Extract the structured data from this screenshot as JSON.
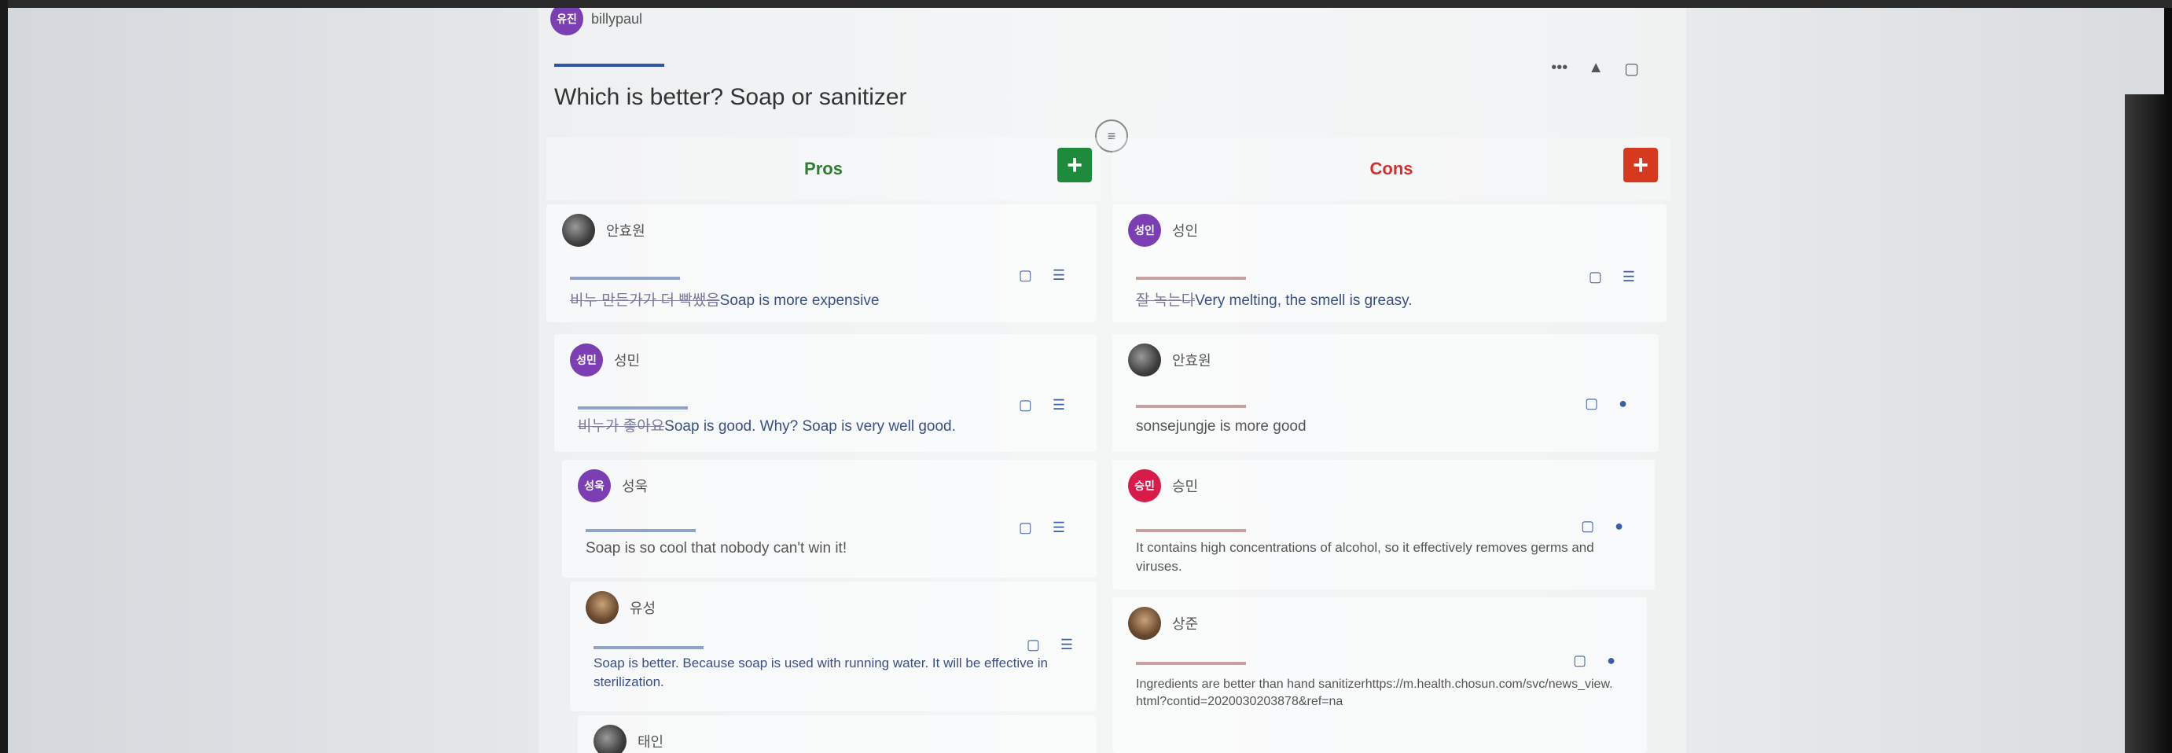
{
  "top_author": {
    "name": "billypaul",
    "initials": "유진"
  },
  "card": {
    "title": "Which is better? Soap or sanitizer"
  },
  "columns": {
    "pros_label": "Pros",
    "cons_label": "Cons",
    "add_symbol": "+"
  },
  "pros": [
    {
      "author": "안효원",
      "struck": "비누 만든가가 더 빡쌨음",
      "text": "Soap is more expensive"
    },
    {
      "author": "성민",
      "initials": "성민",
      "struck": "비누가 좋아요",
      "text": "Soap is good. Why? Soap is very well good."
    },
    {
      "author": "성욱",
      "initials": "성욱",
      "struck": "",
      "text": "Soap is so cool that nobody can't win it!"
    },
    {
      "author": "유성",
      "struck": "",
      "text": "Soap is better. Because soap is used with running water. It will be effective in sterilization."
    },
    {
      "author": "태인",
      "struck": "",
      "text": ""
    }
  ],
  "cons": [
    {
      "author": "성인",
      "initials": "성인",
      "struck": "잘 녹는다",
      "text": "Very melting, the smell is greasy."
    },
    {
      "author": "안효원",
      "struck": "",
      "text": "sonsejungje is more good"
    },
    {
      "author": "승민",
      "initials": "승민",
      "struck": "",
      "text": "It contains high concentrations of alcohol, so it effectively removes germs and viruses."
    },
    {
      "author": "상준",
      "struck": "",
      "text": "Ingredients are better than hand sanitizerhttps://m.health.chosun.com/svc/news_view.html?contid=2020030203878&ref=na"
    }
  ],
  "colors": {
    "pros": "#2e7d32",
    "cons": "#d32f2f",
    "purple_avatar": "#7b3fb3",
    "red_avatar": "#d81b4a"
  }
}
